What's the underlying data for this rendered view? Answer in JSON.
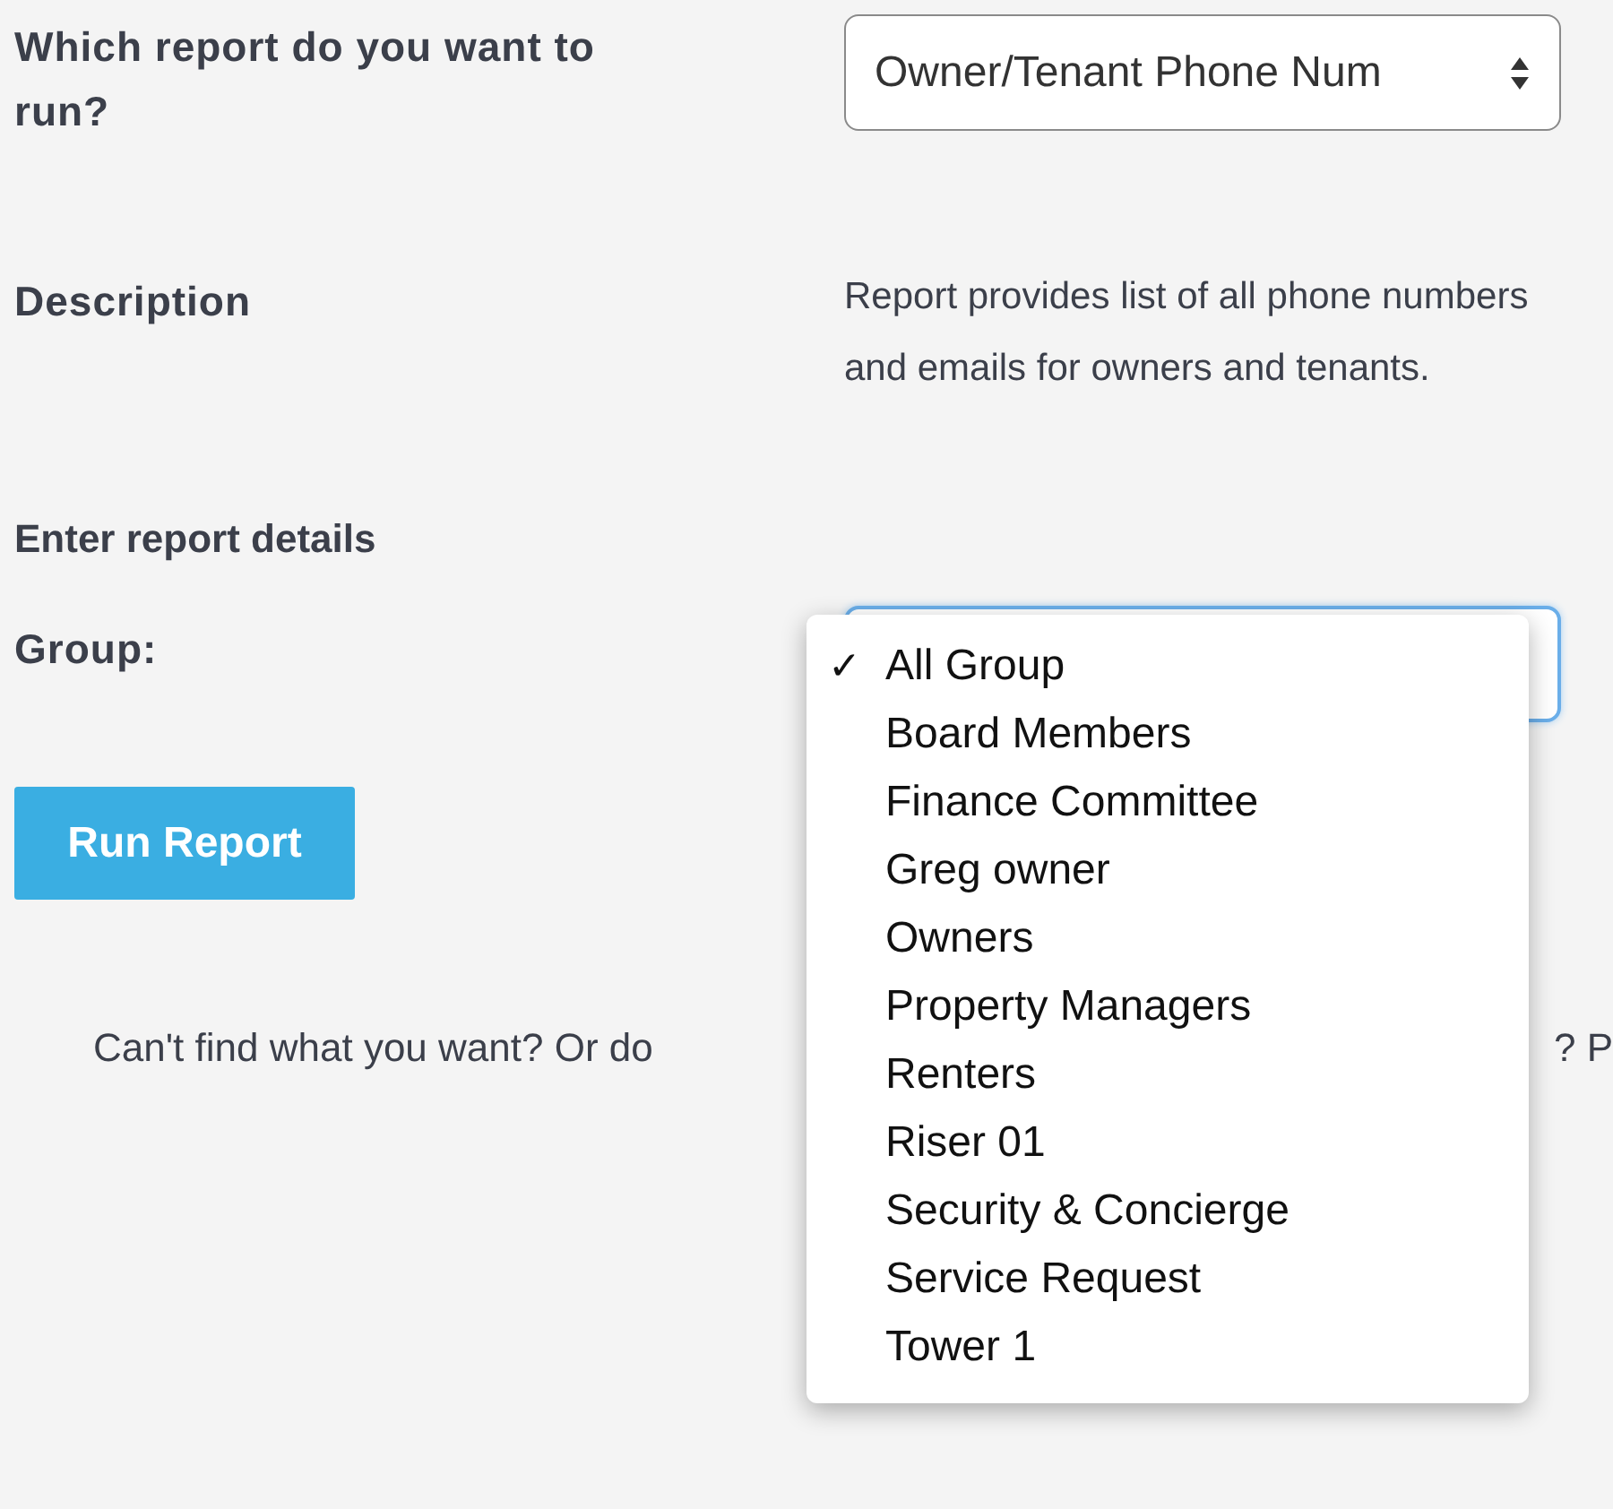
{
  "report_select": {
    "label": "Which report do you want to run?",
    "value": "Owner/Tenant Phone Num"
  },
  "description": {
    "label": "Description",
    "text": "Report provides list of all phone numbers and emails for owners and tenants."
  },
  "details_heading": "Enter report details",
  "group": {
    "label": "Group:",
    "check_mark": "✓",
    "options": [
      {
        "label": "All Group",
        "selected": true
      },
      {
        "label": "Board Members",
        "selected": false
      },
      {
        "label": "Finance Committee",
        "selected": false
      },
      {
        "label": "Greg owner",
        "selected": false
      },
      {
        "label": "Owners",
        "selected": false
      },
      {
        "label": "Property Managers",
        "selected": false
      },
      {
        "label": "Renters",
        "selected": false
      },
      {
        "label": "Riser 01",
        "selected": false
      },
      {
        "label": "Security & Concierge",
        "selected": false
      },
      {
        "label": "Service Request",
        "selected": false
      },
      {
        "label": "Tower 1",
        "selected": false
      }
    ]
  },
  "run_button": "Run Report",
  "footer_text": [
    "Can't find what you want? Or do",
    "? P"
  ]
}
